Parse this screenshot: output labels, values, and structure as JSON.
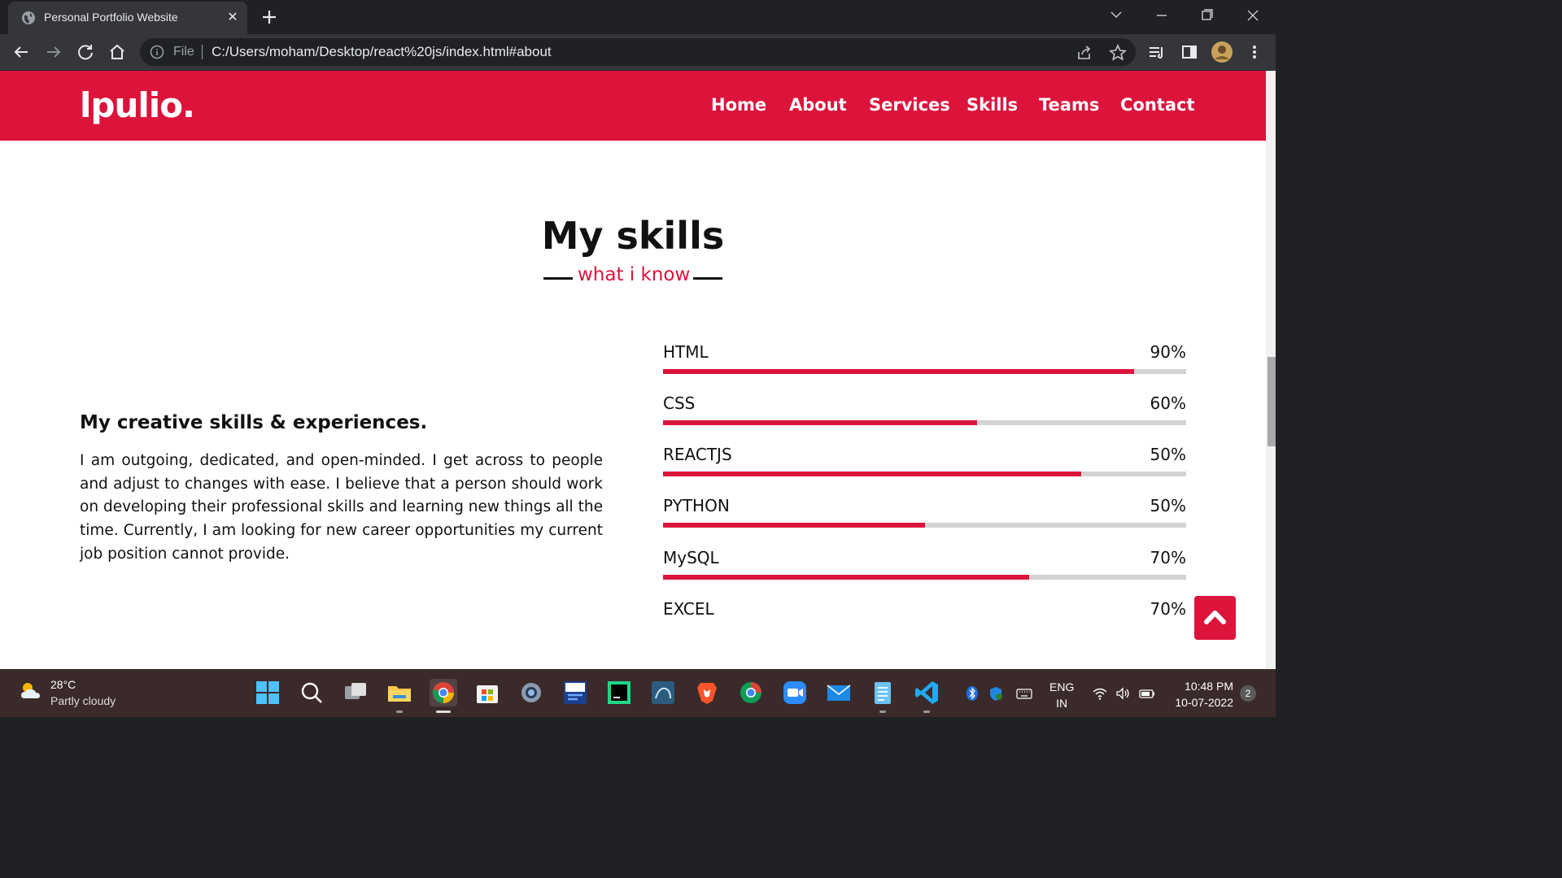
{
  "browser": {
    "tab_title": "Personal Portfolio Website",
    "url_scheme": "File",
    "url": "C:/Users/moham/Desktop/react%20js/index.html#about"
  },
  "site": {
    "logo": "lpulio.",
    "nav": [
      "Home",
      "About",
      "Services",
      "Skills",
      "Teams",
      "Contact"
    ]
  },
  "skills_section": {
    "title": "My skills",
    "subtitle": "what i know",
    "heading": "My creative skills & experiences.",
    "description": "I am outgoing, dedicated, and open-minded. I get across to people and adjust to changes with ease. I believe that a person should work on developing their professional skills and learning new things all the time. Currently, I am looking for new career opportunities my current job position cannot provide.",
    "skills": [
      {
        "name": "HTML",
        "percent_label": "90%",
        "fill_fraction": 0.9
      },
      {
        "name": "CSS",
        "percent_label": "60%",
        "fill_fraction": 0.6
      },
      {
        "name": "REACTJS",
        "percent_label": "50%",
        "fill_fraction": 0.8
      },
      {
        "name": "PYTHON",
        "percent_label": "50%",
        "fill_fraction": 0.5
      },
      {
        "name": "MySQL",
        "percent_label": "70%",
        "fill_fraction": 0.7
      },
      {
        "name": "EXCEL",
        "percent_label": "70%",
        "fill_fraction": null
      }
    ]
  },
  "taskbar": {
    "weather_temp": "28°C",
    "weather_desc": "Partly cloudy",
    "lang_line1": "ENG",
    "lang_line2": "IN",
    "time": "10:48 PM",
    "date": "10-07-2022",
    "notifications": "2",
    "apps": [
      "start-icon",
      "search-icon",
      "task-view-icon",
      "file-explorer-icon",
      "chrome-icon",
      "microsoft-store-icon",
      "settings-icon",
      "devcpp-icon",
      "pycharm-icon",
      "mysql-workbench-icon",
      "brave-icon",
      "chrome-canary-icon",
      "zoom-icon",
      "mail-icon",
      "notepad-icon",
      "vscode-icon"
    ]
  },
  "colors": {
    "accent": "#dc143c",
    "track": "#d3d3d3",
    "taskbar": "#3b2a2a"
  }
}
